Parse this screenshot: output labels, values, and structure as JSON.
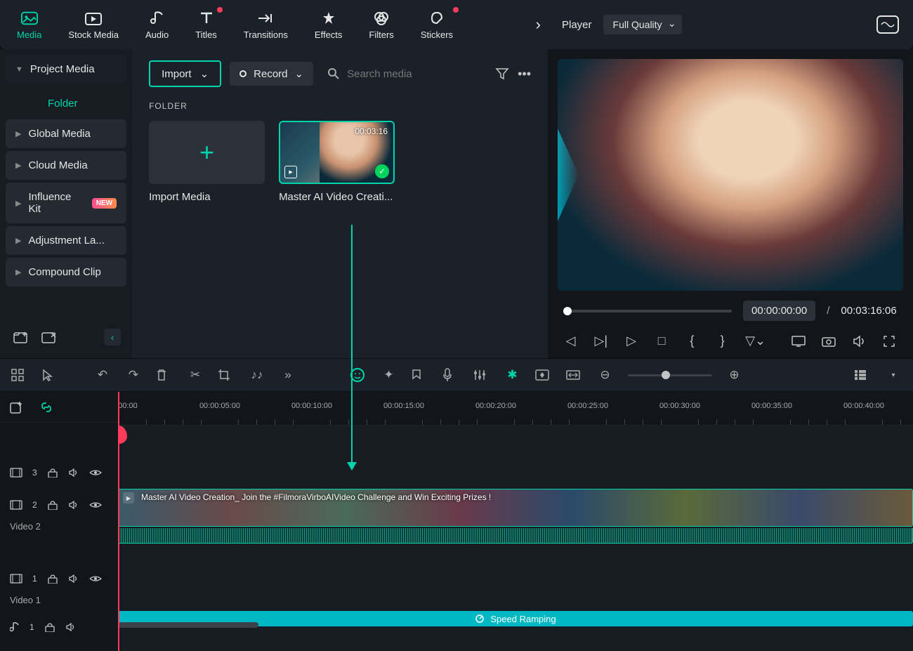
{
  "tabs": [
    {
      "label": "Media",
      "active": true
    },
    {
      "label": "Stock Media",
      "active": false
    },
    {
      "label": "Audio",
      "active": false
    },
    {
      "label": "Titles",
      "active": false,
      "dot": true
    },
    {
      "label": "Transitions",
      "active": false
    },
    {
      "label": "Effects",
      "active": false
    },
    {
      "label": "Filters",
      "active": false
    },
    {
      "label": "Stickers",
      "active": false,
      "dot": true
    }
  ],
  "player": {
    "label": "Player",
    "quality": "Full Quality"
  },
  "sidebar": {
    "project": "Project Media",
    "folder": "Folder",
    "items": [
      {
        "label": "Global Media"
      },
      {
        "label": "Cloud Media"
      },
      {
        "label": "Influence Kit",
        "badge": "NEW"
      },
      {
        "label": "Adjustment La..."
      },
      {
        "label": "Compound Clip"
      }
    ]
  },
  "media": {
    "import_btn": "Import",
    "record_btn": "Record",
    "search_placeholder": "Search media",
    "section": "FOLDER",
    "import_card": "Import Media",
    "clip": {
      "name": "Master AI Video Creati...",
      "duration": "00:03:16"
    }
  },
  "preview": {
    "time_current": "00:00:00:00",
    "time_total": "00:03:16:06"
  },
  "ruler": [
    "00:00",
    "00:00:05:00",
    "00:00:10:00",
    "00:00:15:00",
    "00:00:20:00",
    "00:00:25:00",
    "00:00:30:00",
    "00:00:35:00",
    "00:00:40:00"
  ],
  "tracks": {
    "t3": {
      "num": "3"
    },
    "t2": {
      "num": "2",
      "name": "Video 2"
    },
    "t1": {
      "num": "1",
      "name": "Video 1"
    },
    "a1": {
      "num": "1"
    }
  },
  "clip_strip": "Master AI Video Creation_ Join the #FilmoraVirboAIVideo Challenge and Win Exciting Prizes !",
  "speed": "Speed Ramping"
}
